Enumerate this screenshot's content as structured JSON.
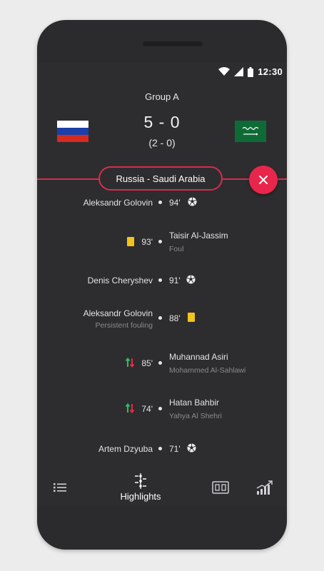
{
  "status": {
    "time": "12:30"
  },
  "match": {
    "group": "Group A",
    "score": "5 - 0",
    "halftime": "(2 - 0)",
    "title": "Russia - Saudi Arabia",
    "home_flag": "russia-flag",
    "away_flag": "saudi-arabia-flag"
  },
  "events": [
    {
      "player": "Aleksandr Golovin",
      "minute": "94'",
      "side": "home",
      "type": "goal"
    },
    {
      "player": "Taisir Al-Jassim",
      "detail": "Foul",
      "minute": "93'",
      "side": "away",
      "type": "yellow-card"
    },
    {
      "player": "Denis Cheryshev",
      "minute": "91'",
      "side": "home",
      "type": "goal"
    },
    {
      "player": "Aleksandr Golovin",
      "detail": "Persistent fouling",
      "minute": "88'",
      "side": "home",
      "type": "yellow-card"
    },
    {
      "player": "Muhannad Asiri",
      "detail": "Mohammed Al-Sahlawi",
      "minute": "85'",
      "side": "away",
      "type": "substitution"
    },
    {
      "player": "Hatan Bahbir",
      "detail": "Yahya Al Shehri",
      "minute": "74'",
      "side": "away",
      "type": "substitution"
    },
    {
      "player": "Artem Dzyuba",
      "minute": "71'",
      "side": "home",
      "type": "goal"
    }
  ],
  "tabs": {
    "lineups_icon": "list-icon",
    "highlights": "Highlights",
    "scoreboard_icon": "scoreboard-icon",
    "stats_icon": "stats-icon"
  },
  "colors": {
    "accent": "#e8264b",
    "yellow_card": "#f2c31b",
    "sub_in": "#2fbf5a",
    "sub_out": "#e8264b"
  }
}
